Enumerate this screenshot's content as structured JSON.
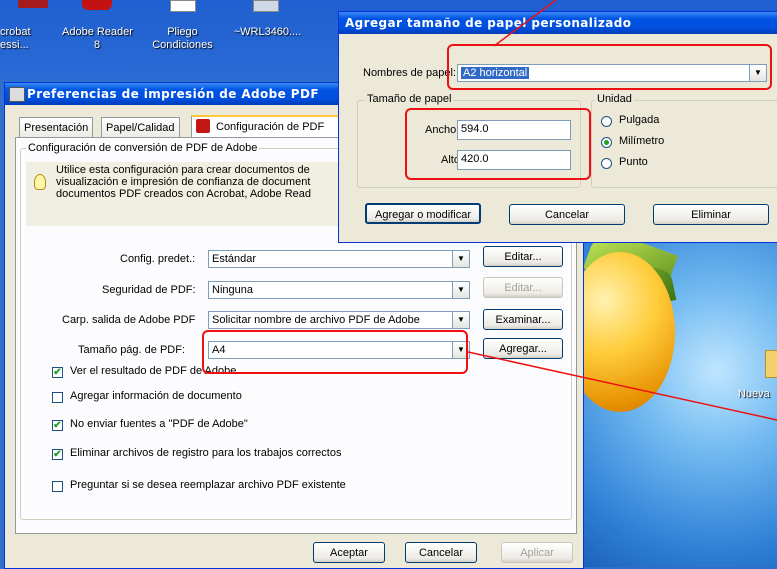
{
  "desktop": {
    "icons": [
      {
        "label": "crobat\nessi...",
        "icon": "acrobat-icon"
      },
      {
        "label": "Adobe Reader\n8",
        "icon": "adobe-reader-icon"
      },
      {
        "label": "Pliego\nCondiciones",
        "icon": "document-icon"
      },
      {
        "label": "~WRL3460....",
        "icon": "document-icon"
      }
    ],
    "new_folder_label": "Nueva"
  },
  "prefs": {
    "title": "Preferencias de impresión de Adobe PDF",
    "tabs": [
      {
        "label": "Presentación"
      },
      {
        "label": "Papel/Calidad"
      },
      {
        "label": "Configuración de PDF"
      }
    ],
    "group_title": "Configuración de conversión de PDF de Adobe",
    "info_text": [
      "Utilice esta configuración para crear documentos de",
      "visualización e impresión de confianza de document",
      "documentos PDF creados con Acrobat, Adobe Read"
    ],
    "rows": {
      "config": {
        "label": "Config. predet.:",
        "value": "Estándar",
        "button": "Editar..."
      },
      "security": {
        "label": "Seguridad de PDF:",
        "value": "Ninguna",
        "button": "Editar..."
      },
      "output": {
        "label": "Carp. salida de Adobe PDF",
        "value": "Solicitar nombre de archivo PDF de Adobe",
        "button": "Examinar..."
      },
      "pagesize": {
        "label": "Tamaño pág. de PDF:",
        "value": "A4",
        "button": "Agregar..."
      }
    },
    "checkboxes": [
      {
        "label": "Ver el resultado de PDF de Adobe",
        "checked": "✔"
      },
      {
        "label": "Agregar información de documento",
        "checked": ""
      },
      {
        "label": "No enviar fuentes a \"PDF de Adobe\"",
        "checked": "✔"
      },
      {
        "label": "Eliminar archivos de registro para los trabajos correctos",
        "checked": "✔"
      },
      {
        "label": "Preguntar si se desea reemplazar archivo PDF existente",
        "checked": ""
      }
    ],
    "buttons": {
      "ok": "Aceptar",
      "cancel": "Cancelar",
      "apply": "Aplicar"
    }
  },
  "custom": {
    "title": "Agregar tamaño de papel personalizado",
    "name_label": "Nombres de papel:",
    "name_value": "A2 horizontal",
    "size_group": "Tamaño de papel",
    "width_label": "Ancho",
    "width_value": "594.0",
    "height_label": "Alto",
    "height_value": "420.0",
    "unit_group": "Unidad",
    "units": [
      {
        "label": "Pulgada",
        "selected": false
      },
      {
        "label": "Milímetro",
        "selected": true
      },
      {
        "label": "Punto",
        "selected": false
      }
    ],
    "buttons": {
      "add": "Agregar o modificar",
      "cancel": "Cancelar",
      "delete": "Eliminar"
    }
  },
  "colors": {
    "annotation": "#ee1111",
    "title_bar": "#0054e3"
  }
}
